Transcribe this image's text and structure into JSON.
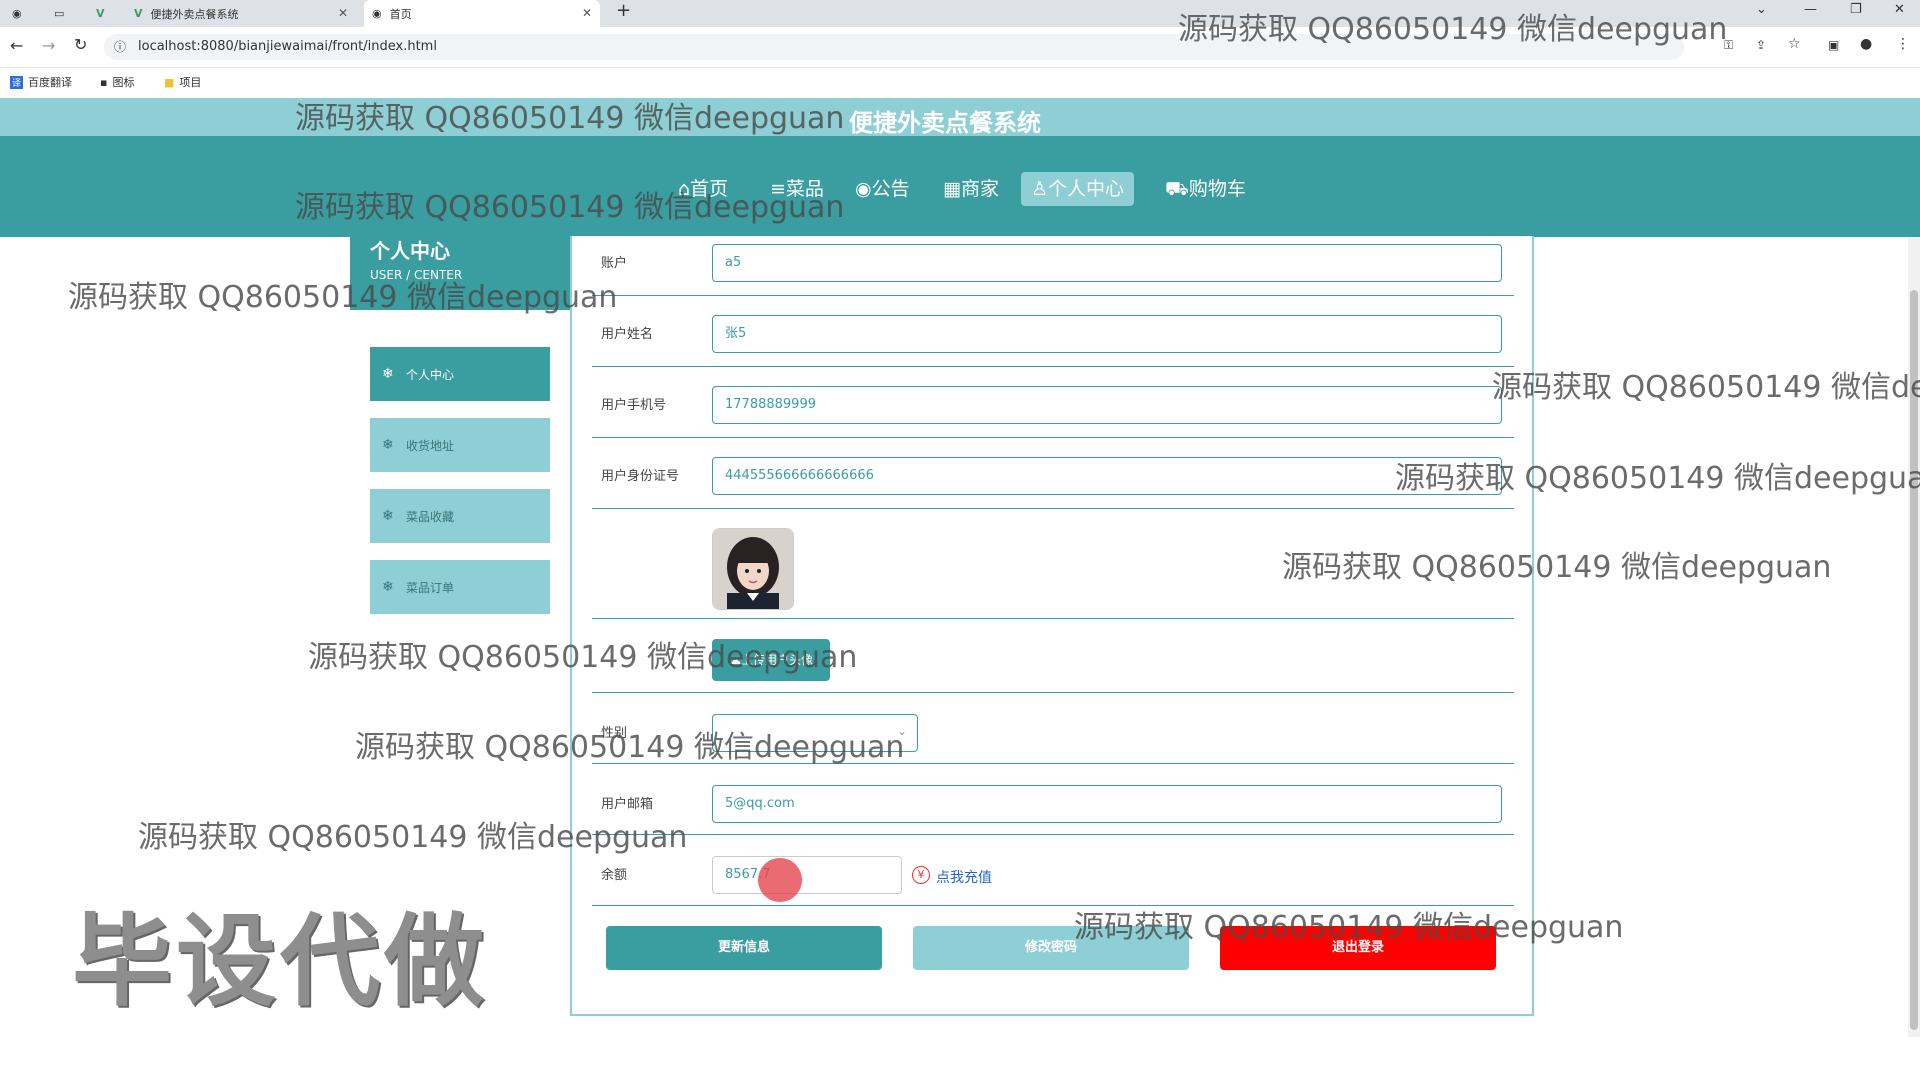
{
  "browser": {
    "tabs": [
      {
        "title": "便捷外卖点餐系统"
      },
      {
        "title": "首页"
      }
    ],
    "url": "localhost:8080/bianjiewaimai/front/index.html",
    "bookmarks": [
      "百度翻译",
      "图标",
      "项目"
    ]
  },
  "site": {
    "title": "便捷外卖点餐系统",
    "nav": [
      {
        "label": "首页",
        "icon": "home-icon"
      },
      {
        "label": "菜品",
        "icon": "menu-icon"
      },
      {
        "label": "公告",
        "icon": "globe-icon"
      },
      {
        "label": "商家",
        "icon": "shop-icon"
      },
      {
        "label": "个人中心",
        "icon": "user-icon",
        "active": true
      },
      {
        "label": "购物车",
        "icon": "cart-icon"
      }
    ]
  },
  "sidebar": {
    "title": "个人中心",
    "subtitle": "USER / CENTER",
    "items": [
      {
        "label": "个人中心",
        "active": true
      },
      {
        "label": "收货地址"
      },
      {
        "label": "菜品收藏"
      },
      {
        "label": "菜品订单"
      }
    ]
  },
  "form": {
    "account": {
      "label": "账户",
      "value": "a5"
    },
    "name": {
      "label": "用户姓名",
      "value": "张5"
    },
    "phone": {
      "label": "用户手机号",
      "value": "17788889999"
    },
    "idcard": {
      "label": "用户身份证号",
      "value": "444555666666666666"
    },
    "upload_label": "上传用户头像",
    "gender": {
      "label": "性别",
      "value": ""
    },
    "email": {
      "label": "用户邮箱",
      "value": "5@qq.com"
    },
    "balance": {
      "label": "余额",
      "value": "8567.7"
    },
    "recharge_label": "点我充值"
  },
  "buttons": {
    "update": "更新信息",
    "password": "修改密码",
    "logout": "退出登录"
  },
  "watermarks": {
    "text": "源码获取 QQ86050149 微信deepguan",
    "text_cut": "源码获取 QQ86050149 微信de",
    "text_cut2": "源码获取 QQ86050149 微信deepguar",
    "big": "毕设代做"
  },
  "colors": {
    "primary": "#3a9d9f",
    "light": "#8dcfd4",
    "danger": "#ff0000"
  }
}
